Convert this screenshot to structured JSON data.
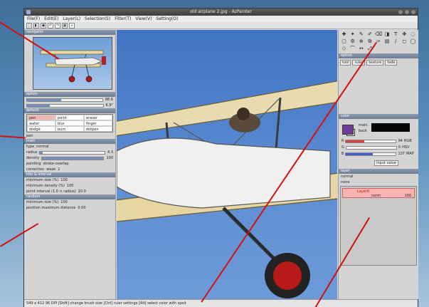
{
  "window": {
    "title": "old airplane 2.jpg - AzPainter"
  },
  "menu": [
    "File(F)",
    "Edit(E)",
    "Layer(L)",
    "Selection(S)",
    "Filter(T)",
    "View(V)",
    "Setting(O)"
  ],
  "toolbar": {
    "icons": [
      "new-icon",
      "open-icon",
      "save-icon",
      "undo-icon",
      "redo-icon",
      "grid-icon",
      "zoom-icon"
    ],
    "glyphs": [
      "□",
      "◧",
      "▣",
      "↶",
      "↷",
      "▦",
      "⌕"
    ]
  },
  "navigator": {
    "title": "navigator"
  },
  "option": {
    "title": "option",
    "zoom": {
      "value": "88.6",
      "fill": 0.45
    },
    "angle": {
      "value": "6.9°",
      "fill": 0.3
    }
  },
  "brush_group": {
    "title": "default",
    "items": [
      "pen",
      "point",
      "eraser",
      "water",
      "blur",
      "finger",
      "dodge",
      "burn",
      "dotpen"
    ],
    "selected": "pen"
  },
  "brush_settings": {
    "name": "pen",
    "section": "main",
    "type_label": "type",
    "type_value": "normal",
    "radius_label": "radius",
    "radius_value": "4.3",
    "radius_fill": 0.04,
    "density_label": "density",
    "density_value": "100",
    "density_fill": 1.0,
    "painting_label": "painting",
    "painting_value": "stroke-overlap",
    "correction_label": "correction",
    "correction_mode": "weak",
    "correction_value": "1",
    "pressure_section": "min & interval",
    "min_size_label": "minimum size (%)",
    "min_size_value": "100",
    "min_density_label": "minimum density (%)",
    "min_density_value": "100",
    "point_interval_label": "point interval (1.0 × radius)",
    "point_interval_value": "20.0",
    "random_section": "random",
    "rand_min_size_label": "minimum size (%)",
    "rand_min_size_value": "100",
    "rand_pos_label": "position maximum distance",
    "rand_pos_value": "0.00"
  },
  "tools": {
    "glyphs": [
      "✚",
      "✦",
      "✎",
      "✐",
      "⌫",
      "◨",
      "T",
      "✥",
      "◌",
      "▢",
      "⚙",
      "⊕",
      "⧉",
      "✑",
      "▤",
      "/",
      "◻",
      "◯",
      "◇",
      "⌒",
      "↔",
      "⤢"
    ]
  },
  "tool_option": {
    "title": "option",
    "tabs": [
      "tool",
      "ruler",
      "texture",
      "fade"
    ]
  },
  "color": {
    "title": "color",
    "main_color": "#6f3d96",
    "back_color": "#ffffff",
    "labels": [
      "main",
      "back"
    ],
    "r_value": "94",
    "g_value": "0",
    "b_value": "137",
    "modes": [
      "RGB",
      "HSV",
      "MAP"
    ],
    "input_button": "input value"
  },
  "layer": {
    "title": "layer",
    "blend": "normal",
    "name_field": "none",
    "layers": [
      {
        "name": "Layer0",
        "opacity": "100",
        "mode": "norm"
      }
    ]
  },
  "status": {
    "text": "549 x 412 96 DPI [Shift] change brush size [Ctrl] ruler settings [Alt] select color with spoit"
  }
}
